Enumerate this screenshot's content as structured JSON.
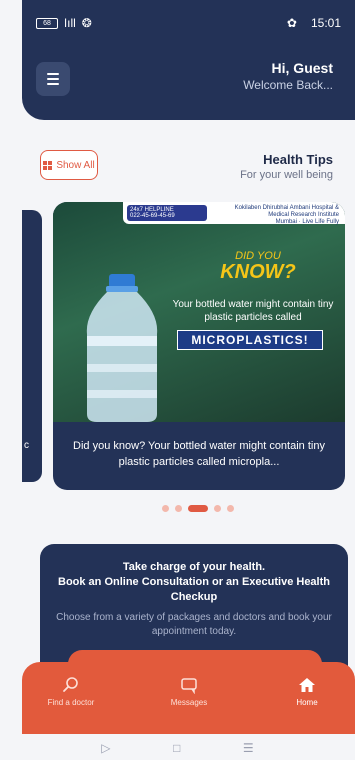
{
  "status_bar": {
    "battery": "68",
    "signal": "ǀıll",
    "time": "15:01",
    "right_icon_glyph": "✿",
    "left_icon_glyph": "❂"
  },
  "header": {
    "greeting": "Hi, Guest",
    "subtitle": "Welcome Back..."
  },
  "health_tips": {
    "title": "Health Tips",
    "subtitle": "For your well being",
    "show_all_label": "Show All"
  },
  "featured_tip": {
    "banner_phone": "24x7 HELPLINE",
    "banner_numbers": "022-45-69-45-69",
    "banner_hospital": "Kokilaben Dhirubhai Ambani Hospital & Medical Research Institute",
    "banner_tag": "Mumbai · Live Life Fully",
    "did_you": "DID YOU",
    "know": "KNOW?",
    "image_text": "Your bottled water might contain tiny plastic particles called",
    "image_highlight": "MICROPLASTICS!",
    "caption": "Did you know? Your bottled water might contain tiny plastic particles called micropla..."
  },
  "side_card": {
    "fragment": "c"
  },
  "carousel": {
    "count": 5,
    "active": 2
  },
  "promo": {
    "line1": "Take charge of your health.",
    "line2": "Book an Online Consultation or an Executive Health Checkup",
    "line3": "Choose from a variety of packages and doctors and book your appointment today."
  },
  "tabs": {
    "home": "Home",
    "messages": "Messages",
    "find_doctor": "Find a doctor"
  },
  "system_nav": {
    "back": "▷",
    "home": "□",
    "recents": "☰"
  },
  "colors": {
    "navy": "#233257",
    "accent": "#e25a3c"
  }
}
